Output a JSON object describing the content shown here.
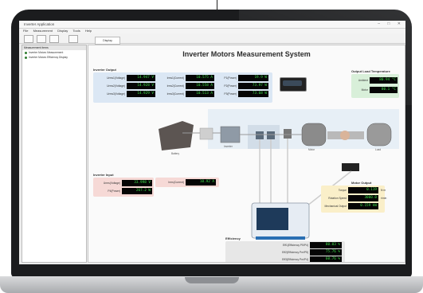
{
  "window": {
    "title": "Inverter Application",
    "controls": "– □ ✕"
  },
  "menu": [
    "File",
    "Measurement",
    "Display",
    "Tools",
    "Help"
  ],
  "toolbar": {
    "tab_label": "Display"
  },
  "tree": {
    "header": "Measurement items",
    "items": [
      "Inverter Motors Measurement",
      "Inverter Motors Efficiency Display"
    ]
  },
  "main_title": "Inverter Motors Measurement System",
  "inverter_output": {
    "label": "Inverter Output",
    "rows": [
      {
        "label": "Urms1(Voltage)",
        "value": "14.947 V"
      },
      {
        "label": "Urms2(Voltage)",
        "value": "14.928 V"
      },
      {
        "label": "Urms3(Voltage)",
        "value": "14.929 V"
      }
    ],
    "currents": [
      {
        "label": "Irms1(Current)",
        "value": "10.575 A"
      },
      {
        "label": "Irms2(Current)",
        "value": "10.558 A"
      },
      {
        "label": "Irms3(Current)",
        "value": "10.513 A"
      }
    ],
    "powers": [
      {
        "label": "P1(Power)",
        "value": "19.9 W"
      },
      {
        "label": "P2(Power)",
        "value": "73.97 W"
      },
      {
        "label": "P3(Power)",
        "value": "73.68 W"
      }
    ]
  },
  "output_load": {
    "label": "Output Load Temperature",
    "rows": [
      {
        "label": "Ambient",
        "value": "80.94 °C"
      },
      {
        "label": "Motor",
        "value": "80.1 °C"
      }
    ]
  },
  "inverter_input": {
    "label": "Inverter Input",
    "rows": [
      {
        "label": "Urms(Voltage)",
        "value": "33.998 V"
      },
      {
        "label": "P4(Power)",
        "value": "267.2 W"
      }
    ],
    "current": {
      "label": "Irms(Current)",
      "value": "10.92 A"
    }
  },
  "motor_output": {
    "label": "Motor Output",
    "rows": [
      {
        "label": "Torque",
        "value": "0.119",
        "unit": "N·m"
      },
      {
        "label": "Rotation Speed",
        "value": "3000.0",
        "unit": "r/min"
      },
      {
        "label": "Mechanical Output",
        "value": "0.159 kW",
        "unit": ""
      }
    ]
  },
  "efficiency": {
    "label": "Efficiency",
    "rows": [
      {
        "label": "Eff1(Efficiency P5/P4)",
        "value": "80.03 %"
      },
      {
        "label": "Eff2(Efficiency Pm/P5)",
        "value": "75.76 %"
      },
      {
        "label": "Eff3(Efficiency Pm/P4)",
        "value": "60.76 %"
      }
    ]
  },
  "diagram_labels": {
    "battery": "Battery",
    "inverter": "Inverter",
    "motor": "Motor",
    "load": "Load"
  },
  "colors": {
    "display_bg": "#050505",
    "display_text": "#3ee04a",
    "accent_blue": "#dbe7f4"
  }
}
